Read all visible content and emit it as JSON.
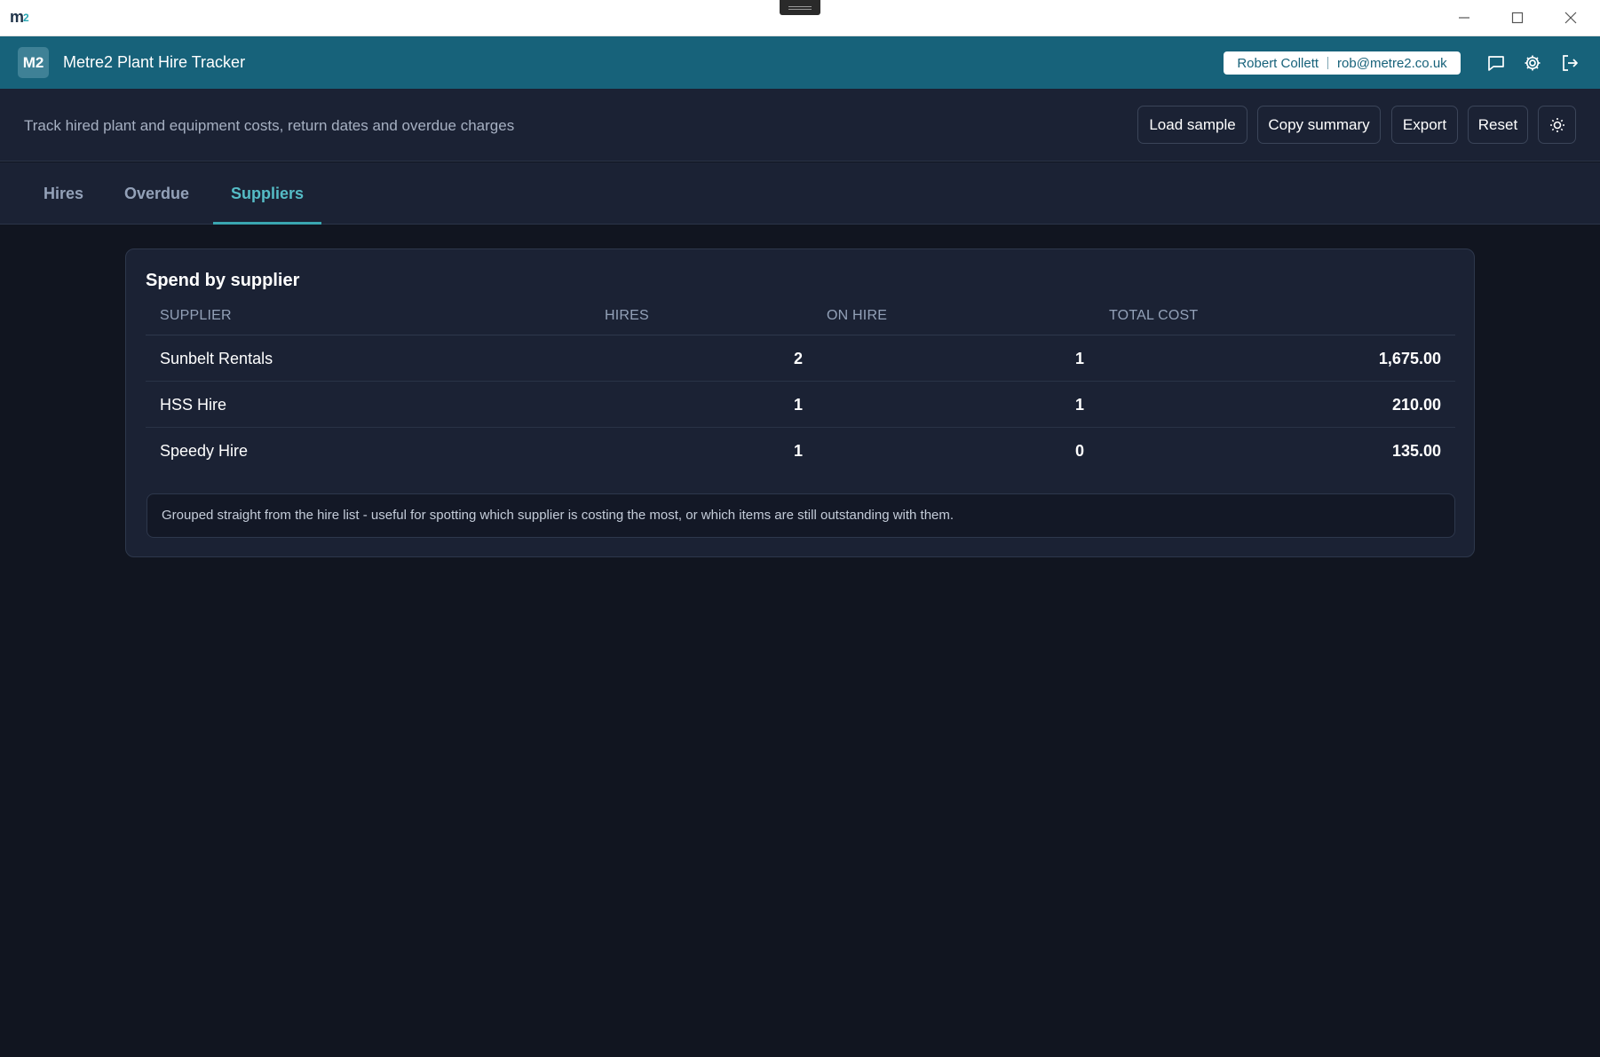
{
  "window": {
    "logo_main": "m",
    "logo_sub": "2"
  },
  "header": {
    "badge": "M2",
    "title": "Metre2 Plant Hire Tracker",
    "user_name": "Robert Collett",
    "user_email": "rob@metre2.co.uk"
  },
  "toolbar": {
    "description": "Track hired plant and equipment costs, return dates and overdue charges",
    "load_sample": "Load sample",
    "copy_summary": "Copy summary",
    "export": "Export",
    "reset": "Reset"
  },
  "tabs": [
    {
      "label": "Hires"
    },
    {
      "label": "Overdue"
    },
    {
      "label": "Suppliers"
    }
  ],
  "suppliers_card": {
    "title": "Spend by supplier",
    "columns": [
      "SUPPLIER",
      "HIRES",
      "ON HIRE",
      "TOTAL COST"
    ],
    "rows": [
      {
        "supplier": "Sunbelt Rentals",
        "hires": "2",
        "on_hire": "1",
        "total_cost": "1,675.00"
      },
      {
        "supplier": "HSS Hire",
        "hires": "1",
        "on_hire": "1",
        "total_cost": "210.00"
      },
      {
        "supplier": "Speedy Hire",
        "hires": "1",
        "on_hire": "0",
        "total_cost": "135.00"
      }
    ],
    "note": "Grouped straight from the hire list - useful for spotting which supplier is costing the most, or which items are still outstanding with them."
  }
}
